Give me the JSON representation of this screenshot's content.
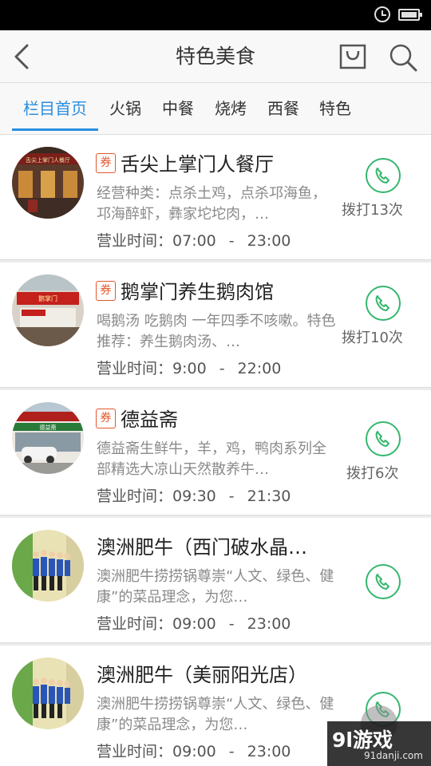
{
  "header": {
    "title": "特色美食"
  },
  "tabs": [
    {
      "label": "栏目首页",
      "active": true
    },
    {
      "label": "火锅"
    },
    {
      "label": "中餐"
    },
    {
      "label": "烧烤"
    },
    {
      "label": "西餐"
    },
    {
      "label": "特色"
    }
  ],
  "restaurants": [
    {
      "coupon": "券",
      "name": "舌尖上掌门人餐厅",
      "desc": "经营种类：点杀土鸡，点杀邛海鱼，邛海醉虾，彝家坨坨肉，…",
      "hours_label": "营业时间：",
      "open": "07:00",
      "dash": "-",
      "close": "23:00",
      "call_text": "拨打13次",
      "sign": "舌尖上掌门人餐厅"
    },
    {
      "coupon": "券",
      "name": "鹅掌门养生鹅肉馆",
      "desc": "喝鹅汤 吃鹅肉 一年四季不咳嗽。特色推荐：养生鹅肉汤、…",
      "hours_label": "营业时间：",
      "open": "9:00",
      "dash": "-",
      "close": "22:00",
      "call_text": "拨打10次",
      "sign": "鹅掌门"
    },
    {
      "coupon": "券",
      "name": "德益斋",
      "desc": "德益斋生鲜牛，羊，鸡，鸭肉系列全部精选大凉山天然散养牛…",
      "hours_label": "营业时间：",
      "open": "09:30",
      "dash": "-",
      "close": "21:30",
      "call_text": "拨打6次",
      "sign": "德益斋"
    },
    {
      "name": "澳洲肥牛（西门破水晶…",
      "desc": "澳洲肥牛捞捞锅尊崇“人文、绿色、健康”的菜品理念，为您…",
      "hours_label": "营业时间：",
      "open": "09:00",
      "dash": "-",
      "close": "23:00"
    },
    {
      "name": "澳洲肥牛（美丽阳光店）",
      "desc": "澳洲肥牛捞捞锅尊崇“人文、绿色、健康”的菜品理念，为您…",
      "hours_label": "营业时间：",
      "open": "09:00",
      "dash": "-",
      "close": "23:00"
    }
  ],
  "watermark": {
    "main": "9l游戏",
    "sub": "91danji.com"
  },
  "colors": {
    "accent": "#2a8ee0",
    "phone": "#34b76e",
    "coupon": "#e4552b"
  },
  "icons": [
    "back-arrow-icon",
    "shopping-bag-icon",
    "search-icon",
    "phone-icon",
    "alarm-icon",
    "battery-icon"
  ]
}
